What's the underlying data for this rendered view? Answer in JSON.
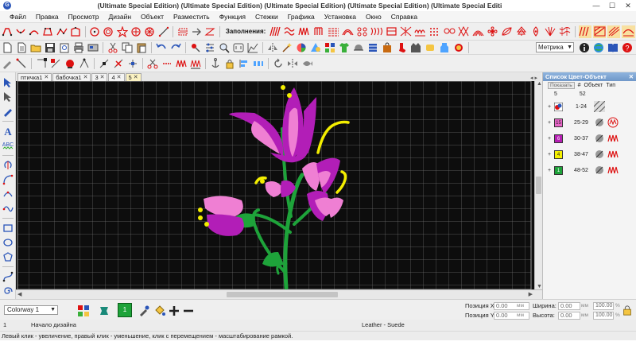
{
  "window": {
    "title": "(Ultimate Special Edition) (Ultimate Special Edition) (Ultimate Special Edition) (Ultimate Special Edition) (Ultimate Special Editi",
    "minimize": "—",
    "maximize": "☐",
    "close": "✕"
  },
  "menu": [
    "Файл",
    "Правка",
    "Просмотр",
    "Дизайн",
    "Объект",
    "Разместить",
    "Функция",
    "Стежки",
    "Графика",
    "Установка",
    "Окно",
    "Справка"
  ],
  "toolbar": {
    "fill_label": "Заполнения:",
    "units": "Метрика"
  },
  "tabs": [
    {
      "label": "птичка1",
      "active": false
    },
    {
      "label": "бабочка1",
      "active": false
    },
    {
      "label": "3",
      "active": false
    },
    {
      "label": "4",
      "active": false
    },
    {
      "label": "5",
      "active": true
    }
  ],
  "tab_close_glyph": "✕",
  "panel": {
    "title": "Список Цвет-Объект",
    "close": "✕",
    "show_button": "Показать",
    "hash_label": "#",
    "object_label": "Объект",
    "type_label": "Тип",
    "col_colors": "5",
    "col_objects": "52",
    "rows": [
      {
        "swatch_label": "",
        "range": "1-24",
        "color": "#ffffff",
        "type_icon": "applique-icon"
      },
      {
        "swatch_label": "15",
        "range": "25-29",
        "color": "#e866c8",
        "type_icon": "satin-icon"
      },
      {
        "swatch_label": "6",
        "range": "30-37",
        "color": "#b61fb3",
        "type_icon": "satin-icon"
      },
      {
        "swatch_label": "4",
        "range": "38-47",
        "color": "#f5f000",
        "type_icon": "satin-icon"
      },
      {
        "swatch_label": "1",
        "range": "48-52",
        "color": "#1ea33a",
        "type_icon": "satin-icon"
      }
    ]
  },
  "bottom": {
    "colorway": "Colorway 1",
    "active_color_number": "1",
    "pos_x_label": "Позиция X:",
    "pos_y_label": "Позиция Y:",
    "pos_x": "0.00",
    "pos_y": "0.00",
    "width_label": "Ширина:",
    "height_label": "Высота:",
    "width": "0.00",
    "height": "0.00",
    "unit": "мм",
    "width_pct": "100.00",
    "height_pct": "100.00",
    "pct_unit": "%"
  },
  "status": {
    "index": "1",
    "message": "Начало дизайна",
    "fabric": "Leather - Suede",
    "hint": "Левый клик - увеличение, правый клик - уменьшение, клик с перемещением - масштабирование рамкой."
  },
  "colors": {
    "canvas_bg": "#0d0d0d",
    "grid": "#6d6d6d",
    "light_pink": "#ef7fd3",
    "dark_purple": "#b21eb7",
    "yellow": "#f3ee00",
    "green": "#1ea33a"
  }
}
